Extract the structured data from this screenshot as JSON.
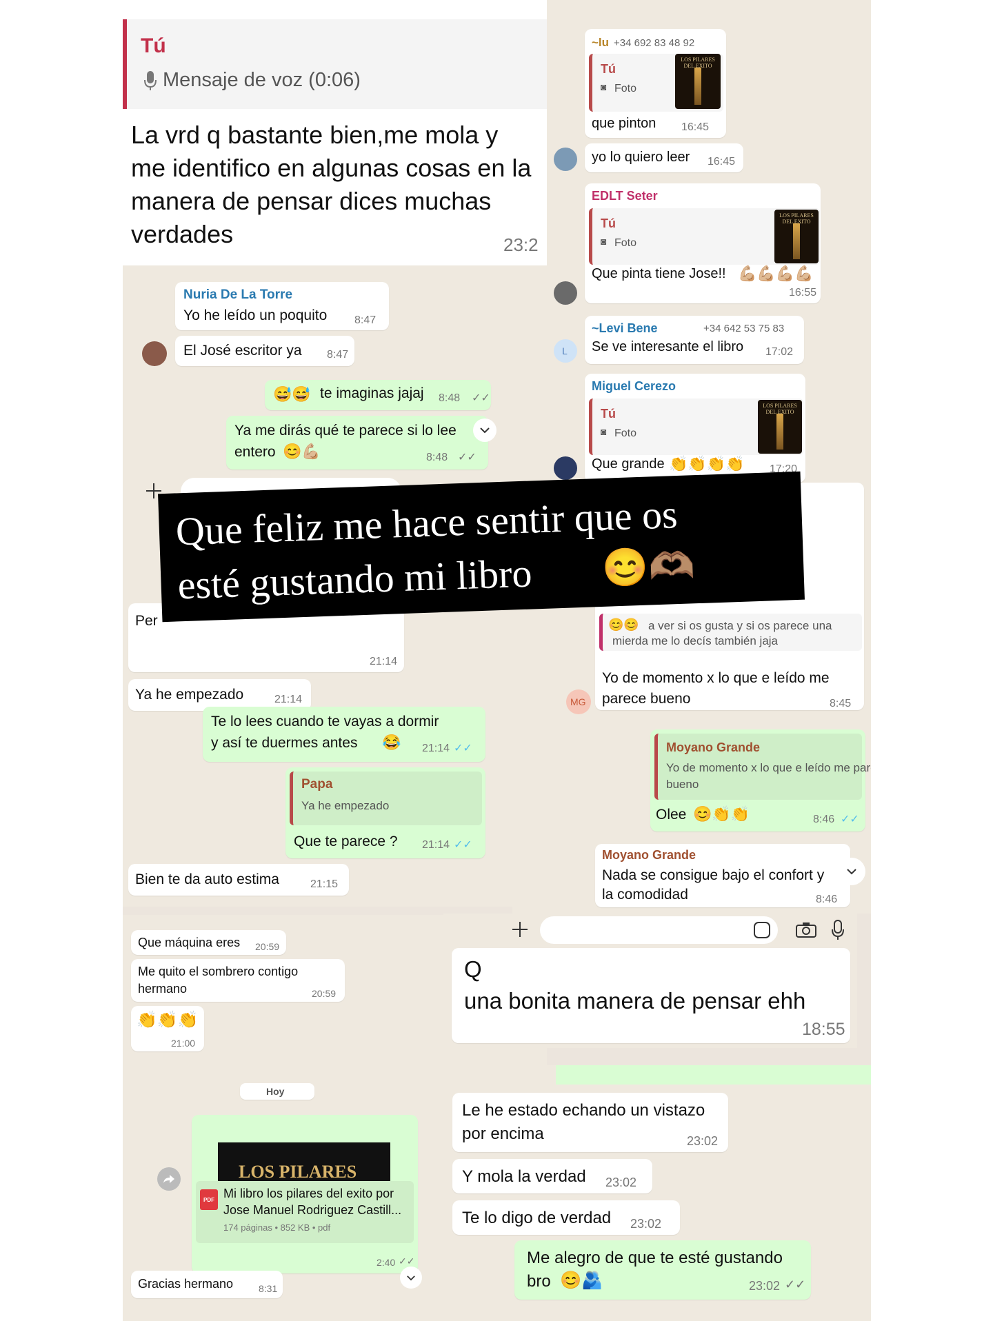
{
  "colors": {
    "outgoing": "#d9fdd3",
    "incoming": "#ffffff",
    "background": "#efe9df",
    "overlay": "#000000",
    "read_tick": "#53bdeb"
  },
  "top_left": {
    "reply_sender": "Tú",
    "voice_label": "Mensaje de voz (0:06)",
    "message": [
      "La vrd q bastante bien,me mola y",
      "me identifico en algunas cosas en la",
      "manera de pensar dices muchas",
      "verdades"
    ],
    "time": "23:2"
  },
  "left_chat1": {
    "m1_sender": "Nuria De La Torre",
    "m1_text": "Yo he leído un poquito",
    "m1_time": "8:47",
    "m2_text": "El José escritor ya",
    "m2_time": "8:47",
    "m3_emoji": "😅😅",
    "m3_text": "te imaginas jajaj",
    "m3_time": "8:48",
    "m4_text1": "Ya me dirás qué te parece si lo lee",
    "m4_text2": "entero",
    "m4_emoji": "😊💪🏼",
    "m4_time": "8:48",
    "plus_icon": "plus-icon"
  },
  "overlay": {
    "line1": "Que feliz me hace sentir que os",
    "line2": "esté gustando mi libro",
    "emoji": "😊🫶🏽"
  },
  "left_chat2": {
    "m0_text": "Per",
    "m0_time": "21:14",
    "m1_text": "Ya he empezado",
    "m1_time": "21:14",
    "m2_text1": "Te lo lees cuando te vayas a dormir",
    "m2_text2": "y así te duermes antes",
    "m2_emoji": "😂",
    "m2_time": "21:14",
    "m3_quote_sender": "Papa",
    "m3_quote_text": "Ya he empezado",
    "m3_text": "Que te parece ?",
    "m3_time": "21:14",
    "m4_text": "Bien te da auto estima",
    "m4_time": "21:15"
  },
  "left_chat3": {
    "m1_text": "Que máquina eres",
    "m1_time": "20:59",
    "m2_text1": "Me quito el sombrero contigo",
    "m2_text2": "hermano",
    "m2_time": "20:59",
    "m3_emoji": "👏👏👏",
    "m3_time": "21:00",
    "date_label": "Hoy",
    "doc_cover": "LOS PILARES",
    "doc_name1": "Mi libro los pilares del exito por",
    "doc_name2": "Jose Manuel Rodriguez Castill...",
    "doc_meta": "174 páginas • 852 KB • pdf",
    "doc_badge": "PDF",
    "doc_time": "2:40",
    "m4_text": "Gracias hermano",
    "m4_time": "8:31"
  },
  "right_chat1": {
    "m1_sender": "~lu",
    "m1_phone": "+34 692 83 48 92",
    "m1_quote_sender": "Tú",
    "m1_quote_type": "Foto",
    "m1_text": "que pinton",
    "m1_time": "16:45",
    "m2_text": "yo lo quiero leer",
    "m2_time": "16:45",
    "m3_sender": "EDLT Seter",
    "m3_quote_sender": "Tú",
    "m3_quote_type": "Foto",
    "m3_text": "Que pinta tiene Jose!!",
    "m3_emoji": "💪🏼💪🏼💪🏼💪🏼",
    "m3_time": "16:55",
    "m4_sender": "~Levi Bene",
    "m4_phone": "+34 642 53 75 83",
    "m4_text": "Se ve interesante el libro",
    "m4_time": "17:02",
    "m4_avatar": "L",
    "m5_sender": "Miguel Cerezo",
    "m5_quote_sender": "Tú",
    "m5_quote_type": "Foto",
    "m5_text": "Que grande",
    "m5_emoji": "👏👏👏👏",
    "m5_time": "17:20",
    "thumb_caption": "LOS PILARES DEL EXITO"
  },
  "right_chat2": {
    "m1_text1": "a ver si os gusta y si os parece una",
    "m1_text2": "mierda me lo decís también jaja",
    "m1_emoji": "😊😊",
    "m1_body1": "Yo de momento x lo que e leído me",
    "m1_body2": "parece bueno",
    "m1_time": "8:45",
    "avatar": "MG",
    "m2_quote_sender": "Moyano Grande",
    "m2_quote_text1": "Yo de momento x lo que e leído me parece",
    "m2_quote_text2": "bueno",
    "m2_text": "Olee",
    "m2_emoji": "😊👏👏",
    "m2_time": "8:46",
    "m3_sender": "Moyano Grande",
    "m3_text1": "Nada se consigue bajo el confort y",
    "m3_text2": "la comodidad",
    "m3_time": "8:46"
  },
  "right_chat3": {
    "m1_text1": "Q",
    "m1_text2": "una bonita manera de pensar ehh",
    "m1_time": "18:55"
  },
  "right_chat4": {
    "m1_text1": "Le he estado echando un vistazo",
    "m1_text2": "por encima",
    "m1_time": "23:02",
    "m2_text": "Y mola la verdad",
    "m2_time": "23:02",
    "m3_text": "Te lo digo de verdad",
    "m3_time": "23:02",
    "m4_text1": "Me alegro de que te esté gustando",
    "m4_text2": "bro",
    "m4_emoji": "😊🫂",
    "m4_time": "23:02"
  }
}
